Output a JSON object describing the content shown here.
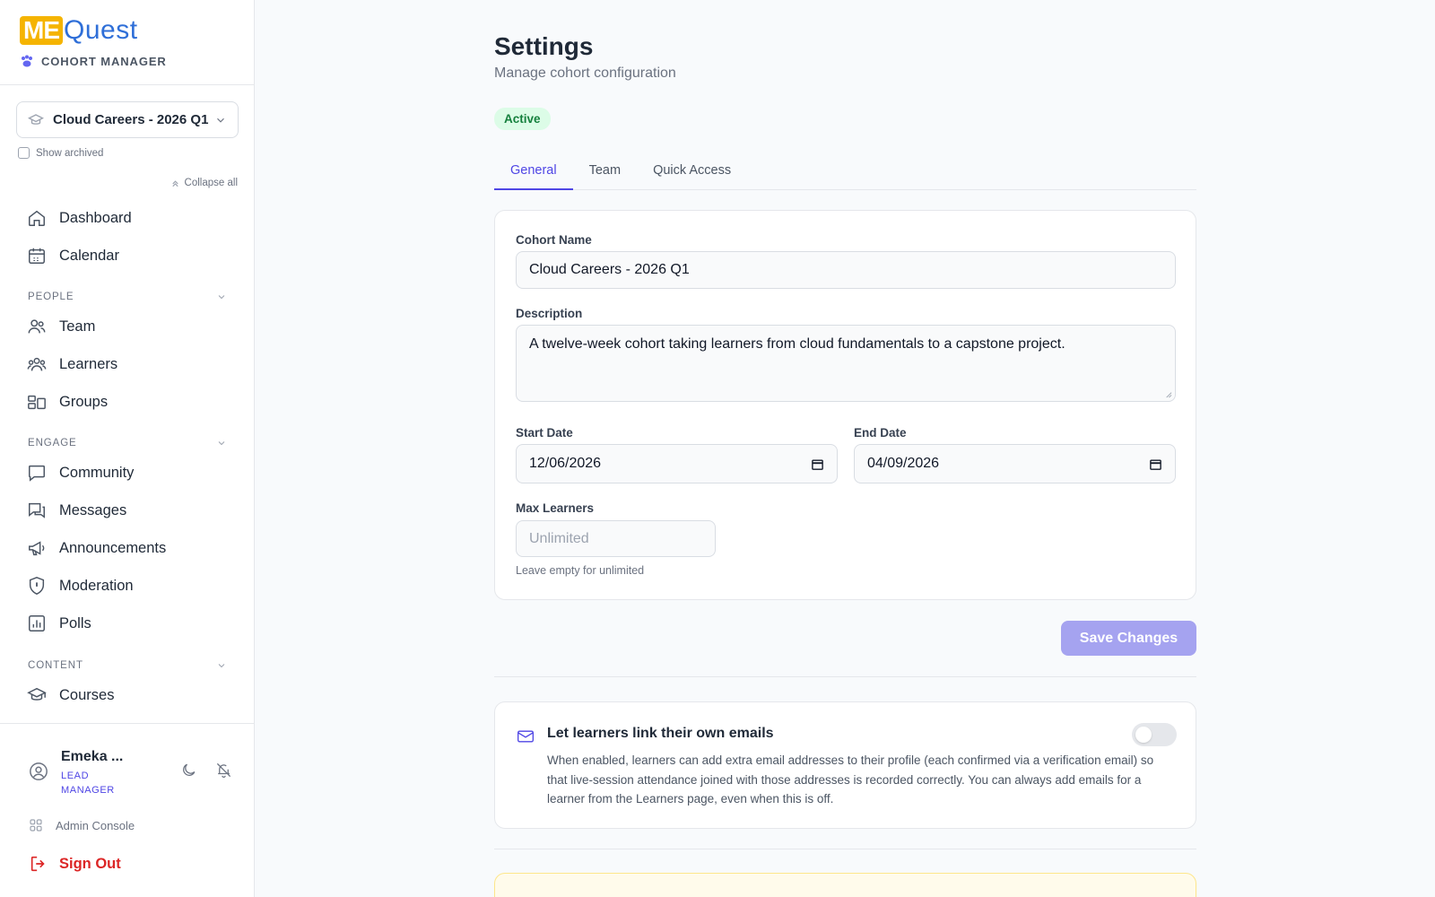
{
  "brand": {
    "logo_me": "ME",
    "logo_quest": "Quest",
    "subtitle": "COHORT MANAGER"
  },
  "cohort_selector": {
    "value": "Cloud Careers - 2026 Q1",
    "show_archived": "Show archived"
  },
  "collapse_all": "Collapse all",
  "nav": {
    "dashboard": "Dashboard",
    "calendar": "Calendar",
    "people_section": "PEOPLE",
    "team": "Team",
    "learners": "Learners",
    "groups": "Groups",
    "engage_section": "ENGAGE",
    "community": "Community",
    "messages": "Messages",
    "announcements": "Announcements",
    "moderation": "Moderation",
    "polls": "Polls",
    "content_section": "CONTENT",
    "courses": "Courses"
  },
  "user": {
    "name": "Emeka ...",
    "role": "LEAD MANAGER"
  },
  "admin_console": "Admin Console",
  "sign_out": "Sign Out",
  "page": {
    "title": "Settings",
    "subtitle": "Manage cohort configuration",
    "status": "Active"
  },
  "tabs": [
    "General",
    "Team",
    "Quick Access"
  ],
  "form": {
    "cohort_name_label": "Cohort Name",
    "cohort_name_value": "Cloud Careers - 2026 Q1",
    "description_label": "Description",
    "description_value": "A twelve-week cohort taking learners from cloud fundamentals to a capstone project.",
    "start_date_label": "Start Date",
    "start_date_value": "12/06/2026",
    "end_date_label": "End Date",
    "end_date_value": "04/09/2026",
    "max_learners_label": "Max Learners",
    "max_learners_placeholder": "Unlimited",
    "max_learners_hint": "Leave empty for unlimited",
    "save_label": "Save Changes"
  },
  "email_setting": {
    "title": "Let learners link their own emails",
    "description": "When enabled, learners can add extra email addresses to their profile (each confirmed via a verification email) so that live-session attendance joined with those addresses is recorded correctly. You can always add emails for a learner from the Learners page, even when this is off.",
    "enabled": false
  },
  "colors": {
    "accent": "#4f46e5",
    "brand_yellow": "#f5b400",
    "brand_blue": "#2f6fd8",
    "danger": "#dc2626",
    "success_bg": "#dcfce7"
  }
}
